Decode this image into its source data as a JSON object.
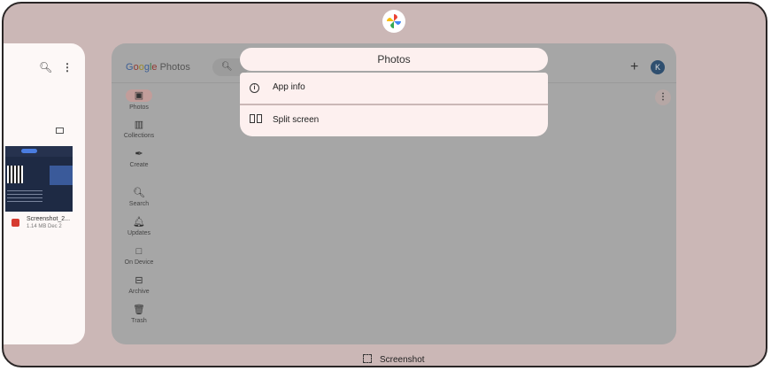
{
  "app_icon": "google-photos-pinwheel-icon",
  "left_card": {
    "search_icon": "search-icon",
    "more_icon": "more-vert-icon",
    "file_name": "Screenshot_2...",
    "file_meta": "1.14 MB Dec 2"
  },
  "main_card": {
    "logo_google": [
      "G",
      "o",
      "o",
      "g",
      "l",
      "e"
    ],
    "logo_photos": "Photos",
    "plus_label": "+",
    "avatar_letter": "K",
    "nav": [
      {
        "label": "Photos",
        "icon": "photo-icon"
      },
      {
        "label": "Collections",
        "icon": "collections-icon"
      },
      {
        "label": "Create",
        "icon": "create-icon"
      },
      {
        "label": "Search",
        "icon": "search-icon"
      },
      {
        "label": "Updates",
        "icon": "bell-icon"
      },
      {
        "label": "On Device",
        "icon": "folder-icon"
      },
      {
        "label": "Archive",
        "icon": "archive-icon"
      },
      {
        "label": "Trash",
        "icon": "trash-icon"
      }
    ]
  },
  "menu": {
    "title": "Photos",
    "items": [
      {
        "label": "App info",
        "icon": "info-icon"
      },
      {
        "label": "Split screen",
        "icon": "split-screen-icon"
      }
    ]
  },
  "bottom_action": {
    "label": "Screenshot",
    "icon": "screenshot-icon"
  }
}
